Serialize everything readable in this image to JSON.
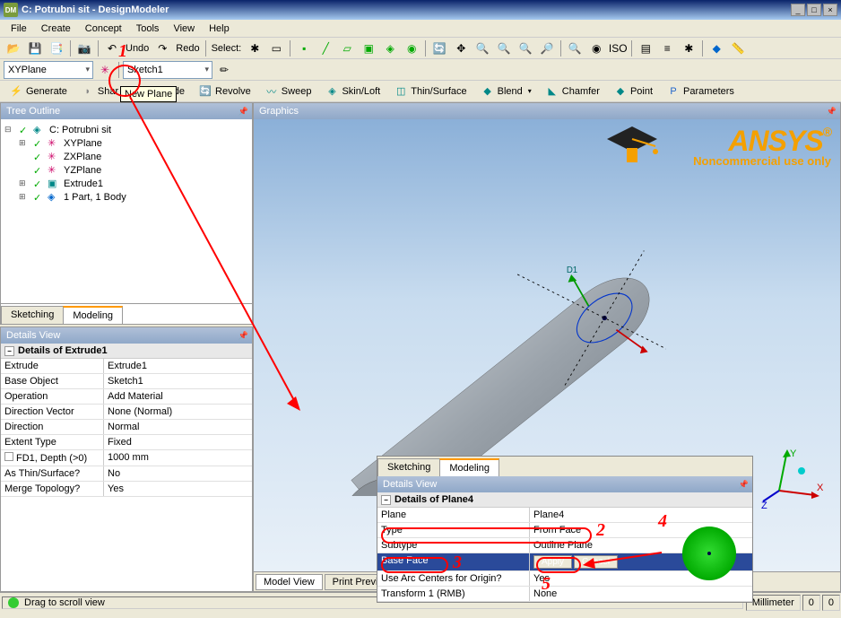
{
  "window": {
    "title": "C: Potrubni sit - DesignModeler"
  },
  "menus": [
    "File",
    "Create",
    "Concept",
    "Tools",
    "View",
    "Help"
  ],
  "toolbar1": {
    "undo": "Undo",
    "redo": "Redo",
    "select": "Select:"
  },
  "planeBar": {
    "plane": "XYPlane",
    "sketch": "Sketch1"
  },
  "modelingBar": {
    "generate": "Generate",
    "share": "Shar",
    "extrude": "Extrude",
    "revolve": "Revolve",
    "sweep": "Sweep",
    "skin": "Skin/Loft",
    "thin": "Thin/Surface",
    "blend": "Blend",
    "chamfer": "Chamfer",
    "point": "Point",
    "params": "Parameters"
  },
  "tooltip": "New Plane",
  "treeOutline": {
    "title": "Tree Outline",
    "root": "C: Potrubni sit",
    "items": [
      "XYPlane",
      "ZXPlane",
      "YZPlane",
      "Extrude1",
      "1 Part, 1 Body"
    ]
  },
  "leftTabs": {
    "sketching": "Sketching",
    "modeling": "Modeling"
  },
  "detailsView": {
    "title": "Details View",
    "caption": "Details of Extrude1",
    "rows": [
      {
        "prop": "Extrude",
        "val": "Extrude1"
      },
      {
        "prop": "Base Object",
        "val": "Sketch1"
      },
      {
        "prop": "Operation",
        "val": "Add Material"
      },
      {
        "prop": "Direction Vector",
        "val": "None (Normal)"
      },
      {
        "prop": "Direction",
        "val": "Normal"
      },
      {
        "prop": "Extent Type",
        "val": "Fixed"
      },
      {
        "prop": "FD1,  Depth (>0)",
        "val": "1000 mm",
        "check": true
      },
      {
        "prop": "As Thin/Surface?",
        "val": "No"
      },
      {
        "prop": "Merge Topology?",
        "val": "Yes"
      }
    ]
  },
  "graphics": {
    "title": "Graphics",
    "dimLabel": "D1",
    "modelView": "Model View",
    "printPreview": "Print Preview",
    "triad": {
      "x": "X",
      "y": "Y",
      "z": "Z"
    }
  },
  "statusbar": {
    "msg": "Drag to scroll view",
    "unit": "Millimeter",
    "v1": "0",
    "v2": "0"
  },
  "anno": {
    "n1": "1",
    "n2": "2",
    "n3": "3",
    "n4": "4",
    "n5": "5"
  },
  "callout": {
    "detailsTitle": "Details View",
    "caption": "Details of Plane4",
    "rows": [
      {
        "prop": "Plane",
        "val": "Plane4"
      },
      {
        "prop": "Type",
        "val": "From Face"
      },
      {
        "prop": "Subtype",
        "val": "Outline Plane"
      },
      {
        "prop": "Base Face",
        "apply": "Apply",
        "cancel": "Cancel"
      },
      {
        "prop": "Use Arc Centers for Origin?",
        "val": "Yes"
      },
      {
        "prop": "Transform 1 (RMB)",
        "val": "None"
      }
    ]
  }
}
